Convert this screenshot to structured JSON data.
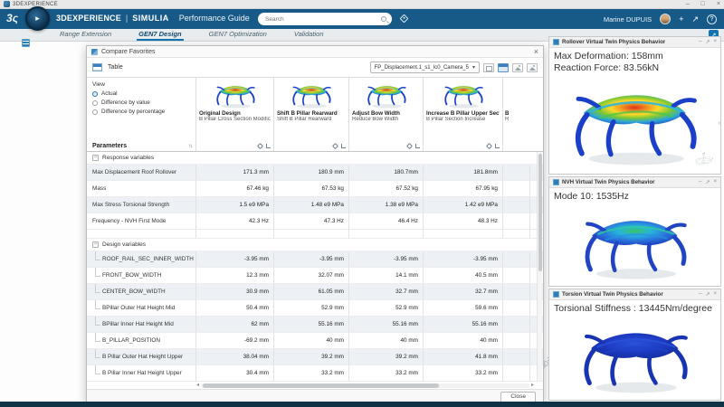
{
  "window": {
    "title": "3DEXPERIENCE"
  },
  "appbar": {
    "brand": "3DEXPERIENCE",
    "divider": "|",
    "product": "SIMULIA",
    "app": "Performance Guide",
    "search_placeholder": "Search",
    "user": "Marine DUPUIS"
  },
  "tabs": [
    {
      "label": "Range Extension",
      "active": false
    },
    {
      "label": "GEN7 Design",
      "active": true
    },
    {
      "label": "GEN7 Optimization",
      "active": false
    },
    {
      "label": "Validation",
      "active": false
    }
  ],
  "dialog": {
    "title": "Compare Favorites",
    "toolbar": {
      "table_label": "Table",
      "view_select": "FP_Displacement.1_s1_lc0_Camera_5"
    },
    "view_options": {
      "label": "View",
      "options": [
        "Actual",
        "Difference by value",
        "Difference by percentage"
      ],
      "selected": "Actual"
    },
    "parameters_label": "Parameters",
    "columns": [
      {
        "name": "Original Design",
        "desc": "B Pillar Cross Section Modification"
      },
      {
        "name": "Shift B Pillar Rearward",
        "desc": "Shift B Pillar Rearward"
      },
      {
        "name": "Adjust Bow Width",
        "desc": "Reduce Bow Width"
      },
      {
        "name": "Increase B Pillar Upper Section",
        "desc": "B Pillar Section Increase"
      }
    ],
    "partial_column": {
      "name": "B",
      "desc": "R"
    },
    "sections": [
      {
        "label": "Response variables",
        "rows": [
          {
            "label": "Max Displacement Roof Rollover",
            "values": [
              "171.3 mm",
              "180.9 mm",
              "180.7mm",
              "181.8mm"
            ]
          },
          {
            "label": "Mass",
            "values": [
              "67.46 kg",
              "67.53 kg",
              "67.52 kg",
              "67.95 kg"
            ]
          },
          {
            "label": "Max Stress Torsional Strength",
            "values": [
              "1.5 e9 MPa",
              "1.48 e9 MPa",
              "1.38 e9 MPa",
              "1.42 e9 MPa"
            ]
          },
          {
            "label": "Frequency - NVH First Mode",
            "values": [
              "42.3 Hz",
              "47.3 Hz",
              "46.4 Hz",
              "48.3 Hz"
            ]
          }
        ]
      },
      {
        "label": "Design variables",
        "rows": [
          {
            "label": "ROOF_RAIL_SEC_INNER_WIDTH",
            "values": [
              "-3.95 mm",
              "-3.95 mm",
              "-3.95 mm",
              "-3.95 mm"
            ]
          },
          {
            "label": "FRONT_BOW_WIDTH",
            "values": [
              "12.3 mm",
              "32.07 mm",
              "14.1 mm",
              "40.5 mm"
            ]
          },
          {
            "label": "CENTER_BOW_WIDTH",
            "values": [
              "30.9 mm",
              "61.05 mm",
              "32.7 mm",
              "32.7 mm"
            ]
          },
          {
            "label": "BPillar Outer Hat Height Mid",
            "values": [
              "50.4 mm",
              "52.9 mm",
              "52.9 mm",
              "59.6 mm"
            ]
          },
          {
            "label": "BPillar Inner Hat Height Mid",
            "values": [
              "62 mm",
              "55.16 mm",
              "55.16 mm",
              "55.16 mm"
            ]
          },
          {
            "label": "B_PILLAR_POSITION",
            "values": [
              "-69.2 mm",
              "40 mm",
              "40 mm",
              "40 mm"
            ]
          },
          {
            "label": "B Pillar Outer Hat Height Upper",
            "values": [
              "38.04 mm",
              "39.2 mm",
              "39.2 mm",
              "41.8 mm"
            ]
          },
          {
            "label": "B Pillar Inner Hat Height Upper",
            "values": [
              "30.4 mm",
              "33.2 mm",
              "33.2 mm",
              "33.2 mm"
            ]
          }
        ]
      }
    ],
    "close_label": "Close"
  },
  "panels": [
    {
      "title": "Rollover Virtual Twin Physics Behavior",
      "lines": [
        "Max Deformation: 158mm",
        "Reaction Force: 83.56kN"
      ],
      "scheme": "rainbow"
    },
    {
      "title": "NVH Virtual Twin Physics Behavior",
      "lines": [
        "Mode 10: 1535Hz"
      ],
      "scheme": "nvh"
    },
    {
      "title": "Torsion Virtual Twin Physics Behavior",
      "lines": [
        "Torsional Stiffness : 13445Nm/degree"
      ],
      "scheme": "torsion"
    }
  ],
  "icons": {
    "minimize": "–",
    "maximize": "□",
    "close": "×",
    "caret": "▾",
    "sort": "↑↓",
    "plus": "+",
    "share": "↗",
    "help": "?",
    "panel_min": "–",
    "panel_pop": "↗",
    "panel_close": "×",
    "scroll_left": "◂",
    "scroll_right": "▸",
    "collapse": "−",
    "expand_widget": "↗",
    "chevron_left": "‹",
    "compass_play": "▸",
    "ds_logo": "3ς"
  },
  "colors": {
    "appbar": "#175a87",
    "accent": "#1273b0",
    "row_alt": "#edf1f5"
  }
}
